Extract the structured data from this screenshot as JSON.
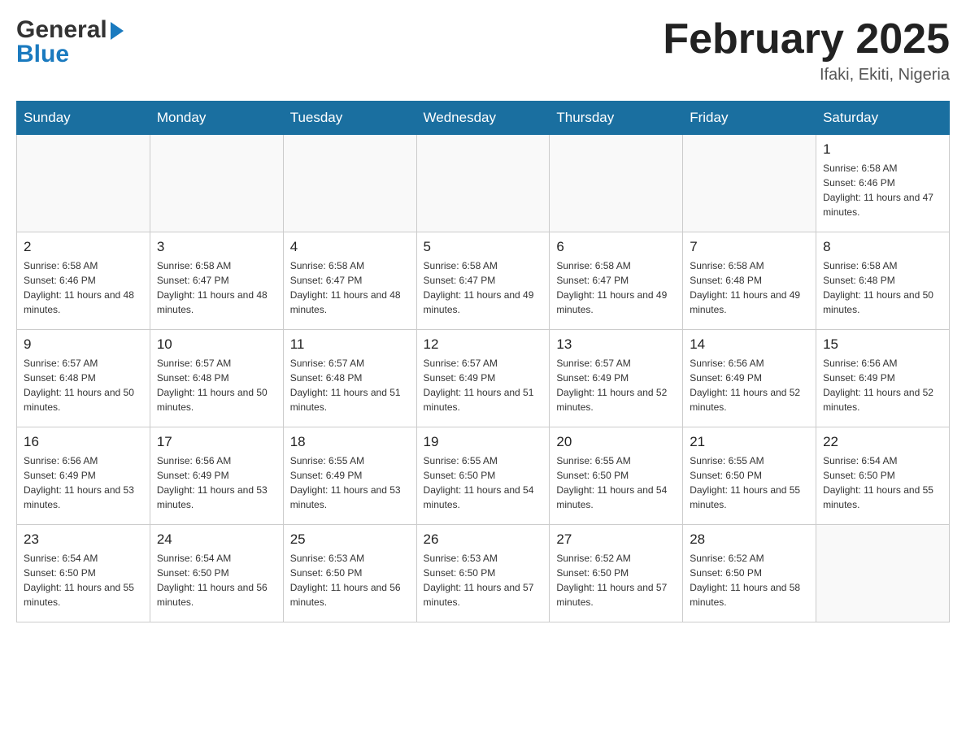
{
  "header": {
    "logo": {
      "general": "General",
      "blue": "Blue",
      "tagline": ""
    },
    "title": "February 2025",
    "subtitle": "Ifaki, Ekiti, Nigeria"
  },
  "weekdays": [
    "Sunday",
    "Monday",
    "Tuesday",
    "Wednesday",
    "Thursday",
    "Friday",
    "Saturday"
  ],
  "weeks": [
    {
      "days": [
        {
          "number": "",
          "info": ""
        },
        {
          "number": "",
          "info": ""
        },
        {
          "number": "",
          "info": ""
        },
        {
          "number": "",
          "info": ""
        },
        {
          "number": "",
          "info": ""
        },
        {
          "number": "",
          "info": ""
        },
        {
          "number": "1",
          "info": "Sunrise: 6:58 AM\nSunset: 6:46 PM\nDaylight: 11 hours and 47 minutes."
        }
      ]
    },
    {
      "days": [
        {
          "number": "2",
          "info": "Sunrise: 6:58 AM\nSunset: 6:46 PM\nDaylight: 11 hours and 48 minutes."
        },
        {
          "number": "3",
          "info": "Sunrise: 6:58 AM\nSunset: 6:47 PM\nDaylight: 11 hours and 48 minutes."
        },
        {
          "number": "4",
          "info": "Sunrise: 6:58 AM\nSunset: 6:47 PM\nDaylight: 11 hours and 48 minutes."
        },
        {
          "number": "5",
          "info": "Sunrise: 6:58 AM\nSunset: 6:47 PM\nDaylight: 11 hours and 49 minutes."
        },
        {
          "number": "6",
          "info": "Sunrise: 6:58 AM\nSunset: 6:47 PM\nDaylight: 11 hours and 49 minutes."
        },
        {
          "number": "7",
          "info": "Sunrise: 6:58 AM\nSunset: 6:48 PM\nDaylight: 11 hours and 49 minutes."
        },
        {
          "number": "8",
          "info": "Sunrise: 6:58 AM\nSunset: 6:48 PM\nDaylight: 11 hours and 50 minutes."
        }
      ]
    },
    {
      "days": [
        {
          "number": "9",
          "info": "Sunrise: 6:57 AM\nSunset: 6:48 PM\nDaylight: 11 hours and 50 minutes."
        },
        {
          "number": "10",
          "info": "Sunrise: 6:57 AM\nSunset: 6:48 PM\nDaylight: 11 hours and 50 minutes."
        },
        {
          "number": "11",
          "info": "Sunrise: 6:57 AM\nSunset: 6:48 PM\nDaylight: 11 hours and 51 minutes."
        },
        {
          "number": "12",
          "info": "Sunrise: 6:57 AM\nSunset: 6:49 PM\nDaylight: 11 hours and 51 minutes."
        },
        {
          "number": "13",
          "info": "Sunrise: 6:57 AM\nSunset: 6:49 PM\nDaylight: 11 hours and 52 minutes."
        },
        {
          "number": "14",
          "info": "Sunrise: 6:56 AM\nSunset: 6:49 PM\nDaylight: 11 hours and 52 minutes."
        },
        {
          "number": "15",
          "info": "Sunrise: 6:56 AM\nSunset: 6:49 PM\nDaylight: 11 hours and 52 minutes."
        }
      ]
    },
    {
      "days": [
        {
          "number": "16",
          "info": "Sunrise: 6:56 AM\nSunset: 6:49 PM\nDaylight: 11 hours and 53 minutes."
        },
        {
          "number": "17",
          "info": "Sunrise: 6:56 AM\nSunset: 6:49 PM\nDaylight: 11 hours and 53 minutes."
        },
        {
          "number": "18",
          "info": "Sunrise: 6:55 AM\nSunset: 6:49 PM\nDaylight: 11 hours and 53 minutes."
        },
        {
          "number": "19",
          "info": "Sunrise: 6:55 AM\nSunset: 6:50 PM\nDaylight: 11 hours and 54 minutes."
        },
        {
          "number": "20",
          "info": "Sunrise: 6:55 AM\nSunset: 6:50 PM\nDaylight: 11 hours and 54 minutes."
        },
        {
          "number": "21",
          "info": "Sunrise: 6:55 AM\nSunset: 6:50 PM\nDaylight: 11 hours and 55 minutes."
        },
        {
          "number": "22",
          "info": "Sunrise: 6:54 AM\nSunset: 6:50 PM\nDaylight: 11 hours and 55 minutes."
        }
      ]
    },
    {
      "days": [
        {
          "number": "23",
          "info": "Sunrise: 6:54 AM\nSunset: 6:50 PM\nDaylight: 11 hours and 55 minutes."
        },
        {
          "number": "24",
          "info": "Sunrise: 6:54 AM\nSunset: 6:50 PM\nDaylight: 11 hours and 56 minutes."
        },
        {
          "number": "25",
          "info": "Sunrise: 6:53 AM\nSunset: 6:50 PM\nDaylight: 11 hours and 56 minutes."
        },
        {
          "number": "26",
          "info": "Sunrise: 6:53 AM\nSunset: 6:50 PM\nDaylight: 11 hours and 57 minutes."
        },
        {
          "number": "27",
          "info": "Sunrise: 6:52 AM\nSunset: 6:50 PM\nDaylight: 11 hours and 57 minutes."
        },
        {
          "number": "28",
          "info": "Sunrise: 6:52 AM\nSunset: 6:50 PM\nDaylight: 11 hours and 58 minutes."
        },
        {
          "number": "",
          "info": ""
        }
      ]
    }
  ]
}
